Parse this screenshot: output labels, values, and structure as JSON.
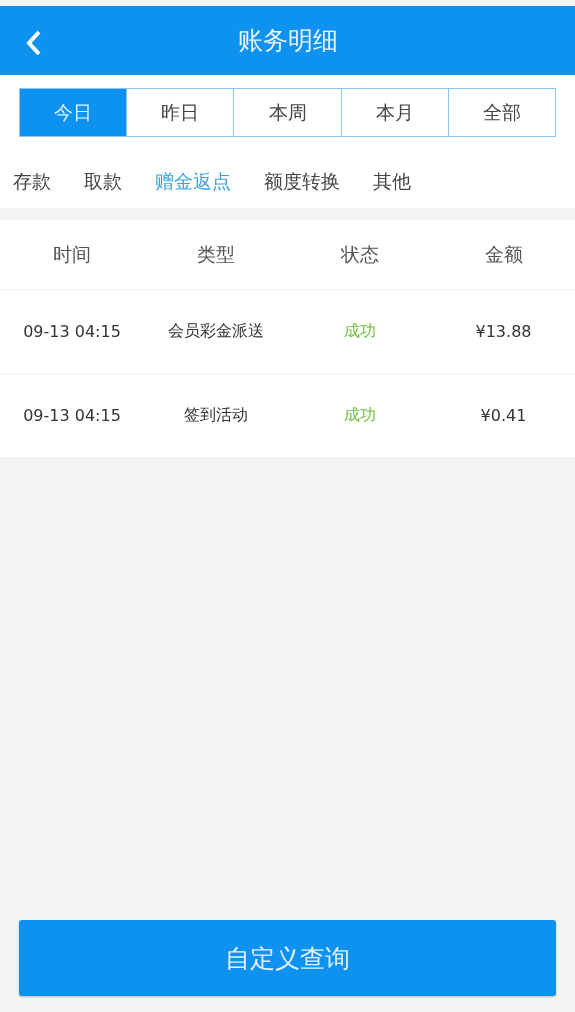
{
  "header": {
    "title": "账务明细"
  },
  "periods": [
    {
      "label": "今日",
      "selected": true
    },
    {
      "label": "昨日",
      "selected": false
    },
    {
      "label": "本周",
      "selected": false
    },
    {
      "label": "本月",
      "selected": false
    },
    {
      "label": "全部",
      "selected": false
    }
  ],
  "categories": [
    {
      "label": "存款",
      "selected": false
    },
    {
      "label": "取款",
      "selected": false
    },
    {
      "label": "赠金返点",
      "selected": true
    },
    {
      "label": "额度转换",
      "selected": false
    },
    {
      "label": "其他",
      "selected": false
    }
  ],
  "table": {
    "columns": [
      "时间",
      "类型",
      "状态",
      "金额"
    ],
    "rows": [
      {
        "time": "09-13 04:15",
        "type": "会员彩金派送",
        "status": "成功",
        "amount": "¥13.88"
      },
      {
        "time": "09-13 04:15",
        "type": "签到活动",
        "status": "成功",
        "amount": "¥0.41"
      }
    ]
  },
  "query_button": "自定义查询"
}
